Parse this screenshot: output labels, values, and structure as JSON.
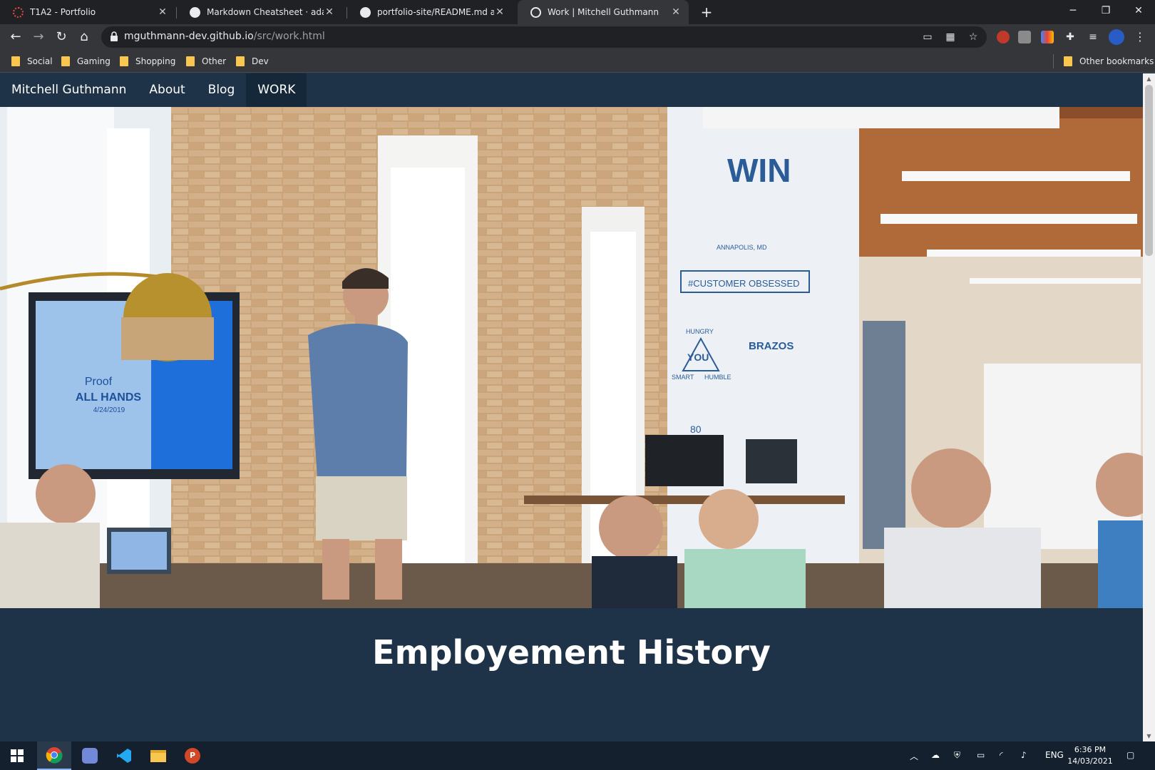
{
  "browser": {
    "tabs": [
      {
        "title": "T1A2 - Portfolio",
        "active": false
      },
      {
        "title": "Markdown Cheatsheet · adam-p/",
        "active": false
      },
      {
        "title": "portfolio-site/README.md at ma",
        "active": false
      },
      {
        "title": "Work | Mitchell Guthmann",
        "active": true
      }
    ],
    "address": {
      "host": "mguthmann-dev.github.io",
      "path": "/src/work.html"
    },
    "bookmarks": [
      "Social",
      "Gaming",
      "Shopping",
      "Other",
      "Dev"
    ],
    "other_bookmarks": "Other bookmarks"
  },
  "site": {
    "brand": "Mitchell Guthmann",
    "nav": [
      "About",
      "Blog",
      "WORK"
    ],
    "hero_slide": {
      "line1": "Proof",
      "line2": "ALL HANDS",
      "date": "4/24/2019"
    },
    "mural": {
      "win": "WIN",
      "city": "ANNAPOLIS, MD",
      "banner": "#CUSTOMER OBSESSED",
      "hungry": "HUNGRY",
      "you": "YOU",
      "smart": "SMART",
      "humble": "HUMBLE",
      "brazos": "BRAZOS",
      "mug": "80"
    },
    "section_title": "Employement History"
  },
  "taskbar": {
    "language": "ENG",
    "time": "6:36 PM",
    "date": "14/03/2021"
  },
  "colors": {
    "nav_bg": "#1e3347",
    "nav_active": "#14283a",
    "chrome_dark": "#202124",
    "chrome_toolbar": "#35363a"
  }
}
